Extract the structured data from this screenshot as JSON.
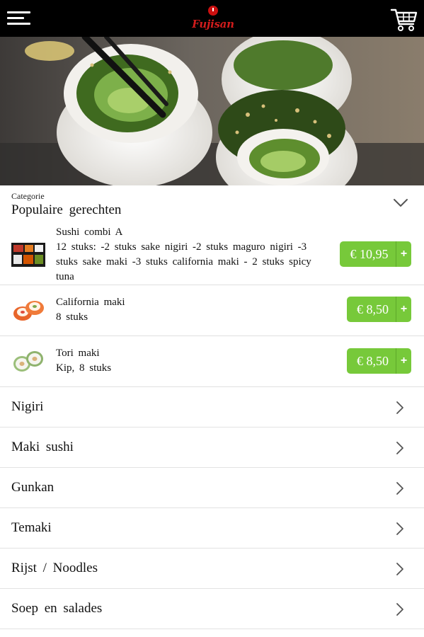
{
  "header": {
    "logo_text": "Fujisan",
    "menu_icon": "hamburger-menu-icon",
    "cart_icon": "shopping-cart-icon"
  },
  "category": {
    "caption": "Categorie",
    "selected": "Populaire gerechten"
  },
  "products": [
    {
      "name": "Sushi combi A",
      "description": "12 stuks: -2 stuks sake nigiri -2 stuks maguro nigiri -3 stuks sake maki -3 stuks california maki - 2 stuks spicy tuna",
      "price": "€ 10,95",
      "add_label": "+"
    },
    {
      "name": "California maki",
      "description": "8 stuks",
      "price": "€ 8,50",
      "add_label": "+"
    },
    {
      "name": "Tori maki",
      "description": "Kip, 8 stuks",
      "price": "€ 8,50",
      "add_label": "+"
    }
  ],
  "categories": [
    {
      "label": "Nigiri"
    },
    {
      "label": "Maki sushi"
    },
    {
      "label": "Gunkan"
    },
    {
      "label": "Temaki"
    },
    {
      "label": "Rijst / Noodles"
    },
    {
      "label": "Soep en salades"
    }
  ],
  "colors": {
    "header_bg": "#000000",
    "brand_red": "#d21c1c",
    "price_green": "#77c93a"
  }
}
